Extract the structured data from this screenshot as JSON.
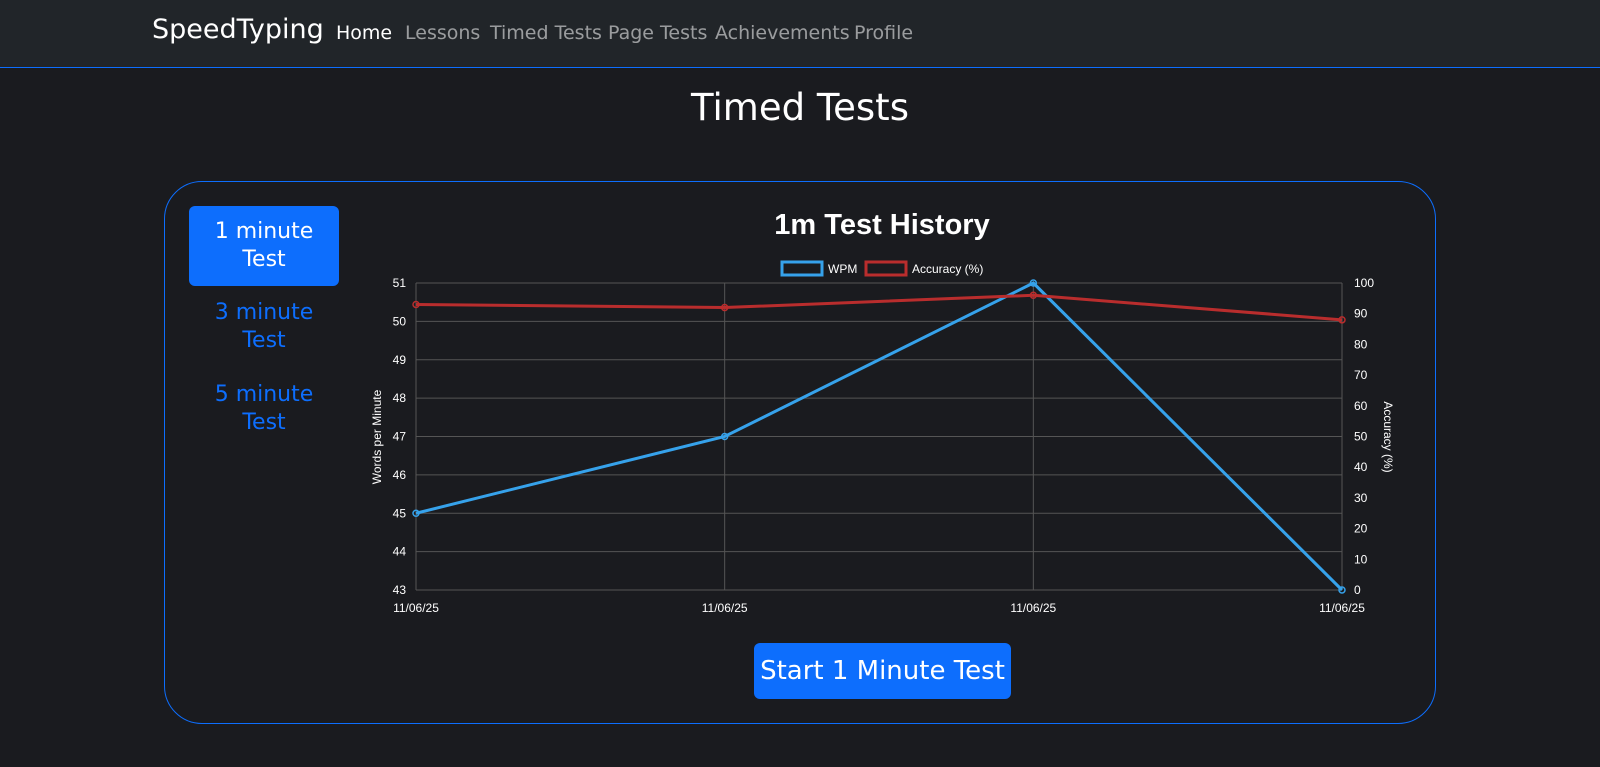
{
  "nav": {
    "brand": "SpeedTyping",
    "links": [
      "Home",
      "Lessons",
      "Timed Tests",
      "Page Tests",
      "Achievements",
      "Profile"
    ]
  },
  "page": {
    "title": "Timed Tests"
  },
  "tests": [
    {
      "label": "1 minute Test",
      "active": true
    },
    {
      "label": "3 minute Test",
      "active": false
    },
    {
      "label": "5 minute Test",
      "active": false
    }
  ],
  "start_button": "Start 1 Minute Test",
  "chart_data": {
    "type": "line",
    "title": "1m Test History",
    "categories": [
      "11/06/25",
      "11/06/25",
      "11/06/25",
      "11/06/25"
    ],
    "series": [
      {
        "name": "WPM",
        "axis": "left",
        "color": "#36a2eb",
        "values": [
          45,
          47,
          51,
          43
        ]
      },
      {
        "name": "Accuracy (%)",
        "axis": "right",
        "color": "#b92d2d",
        "values": [
          93,
          92,
          96,
          88
        ]
      }
    ],
    "ylabel": "Words per Minute",
    "y2label": "Accuracy (%)",
    "ylim": [
      43,
      51
    ],
    "y2lim": [
      0,
      100
    ],
    "yticks": [
      "43",
      "44",
      "45",
      "46",
      "47",
      "48",
      "49",
      "50",
      "51"
    ],
    "y2ticks": [
      "0",
      "10",
      "20",
      "30",
      "40",
      "50",
      "60",
      "70",
      "80",
      "90",
      "100"
    ],
    "grid": true,
    "legend": "top-center"
  },
  "colors": {
    "accent": "#0d6efd",
    "background": "#1a1b1f",
    "navbar": "#212529",
    "grid": "#555555"
  }
}
